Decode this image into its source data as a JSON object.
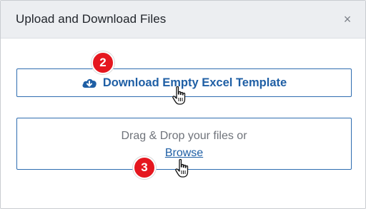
{
  "dialog": {
    "title": "Upload and Download Files",
    "close_icon": "close-icon",
    "close_glyph": "×"
  },
  "download": {
    "label": "Download Empty Excel Template",
    "icon": "cloud-download-icon"
  },
  "dropzone": {
    "text": "Drag & Drop your files or",
    "browse_label": "Browse"
  },
  "annotations": {
    "step_download": "2",
    "step_browse": "3",
    "cursor_icon": "hand-pointer-icon"
  },
  "colors": {
    "accent": "#1f5fa5",
    "badge": "#e5171f",
    "header_bg": "#eceef1"
  }
}
